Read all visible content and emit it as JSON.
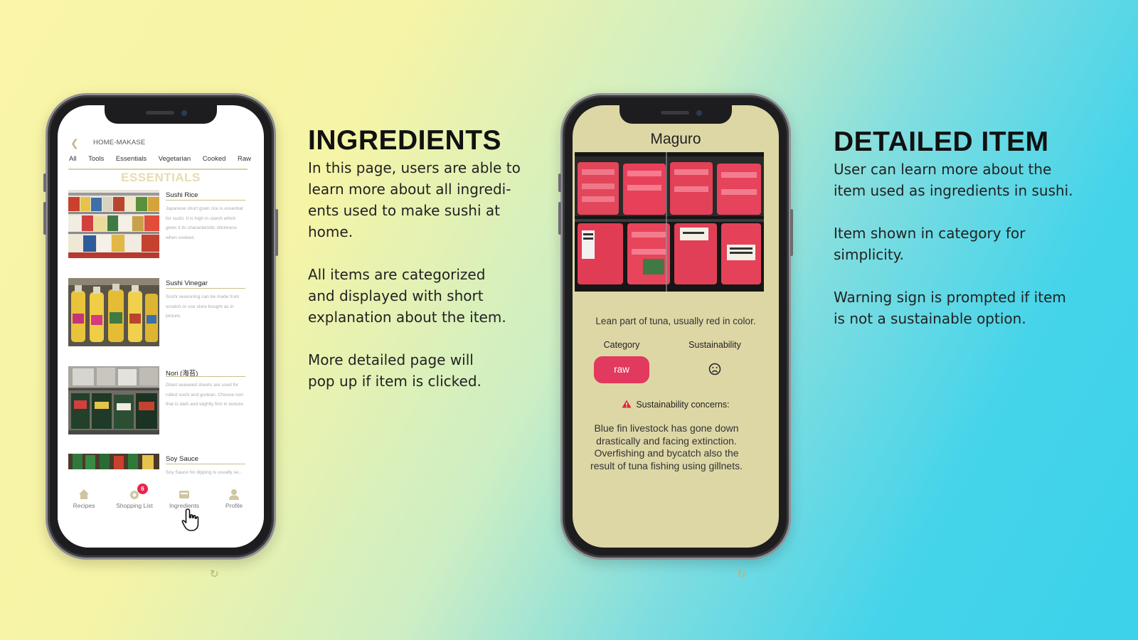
{
  "phone1": {
    "header_title": "HOME-MAKASE",
    "categories": [
      "All",
      "Tools",
      "Essentials",
      "Vegetarian",
      "Cooked",
      "Raw"
    ],
    "section_title": "ESSENTIALS",
    "items": [
      {
        "name": "Sushi Rice",
        "description": "Japanese short grain rice is essential for sushi. It is high in starch which gives it its characteristic stickiness when cooked."
      },
      {
        "name": "Sushi Vinegar",
        "description": "Sushi seasoning can be made from scratch or use store bought as in picture."
      },
      {
        "name": "Nori (海苔)",
        "description": "Dried seaweed sheets are used for rolled sushi and gunkan. Choose nori that is dark and slightly firm in texture."
      },
      {
        "name": "Soy Sauce",
        "description": "Soy Sauce for dipping is usually se..."
      }
    ],
    "tabs": [
      {
        "label": "Recipes",
        "icon": "home-icon"
      },
      {
        "label": "Shopping List",
        "icon": "cart-icon",
        "badge": "6"
      },
      {
        "label": "Ingredients",
        "icon": "ingredients-icon"
      },
      {
        "label": "Profile",
        "icon": "profile-icon"
      }
    ]
  },
  "phone2": {
    "title": "Maguro",
    "description": "Lean part of tuna, usually red in color.",
    "category_label": "Category",
    "sustainability_label": "Sustainability",
    "category_value": "raw",
    "sustainability_icon": "sad-face-icon",
    "concerns_label": "Sustainability concerns:",
    "concerns_text": "Blue fin livestock has gone down drastically and facing extinction. Overfishing and bycatch also the result of tuna fishing using gillnets."
  },
  "ingredients_section": {
    "heading": "INGREDIENTS",
    "paragraphs": [
      "In this page, users are able to\nlearn more about all ingredi-\nents used to make sushi at\nhome.",
      "All items are categorized\nand displayed with short\nexplanation about the item.",
      "More detailed page will\npop up if item is clicked."
    ]
  },
  "detailed_section": {
    "heading": "DETAILED ITEM",
    "paragraphs": [
      "User can learn more about the\nitem used as ingredients in sushi.",
      "Item shown in category for\nsimplicity.",
      "Warning sign is prompted if item\nis not a sustainable option."
    ]
  },
  "colors": {
    "accent_red": "#e2395e",
    "gold_accent": "#c8bd8e",
    "detail_background": "#ddd7a6"
  }
}
